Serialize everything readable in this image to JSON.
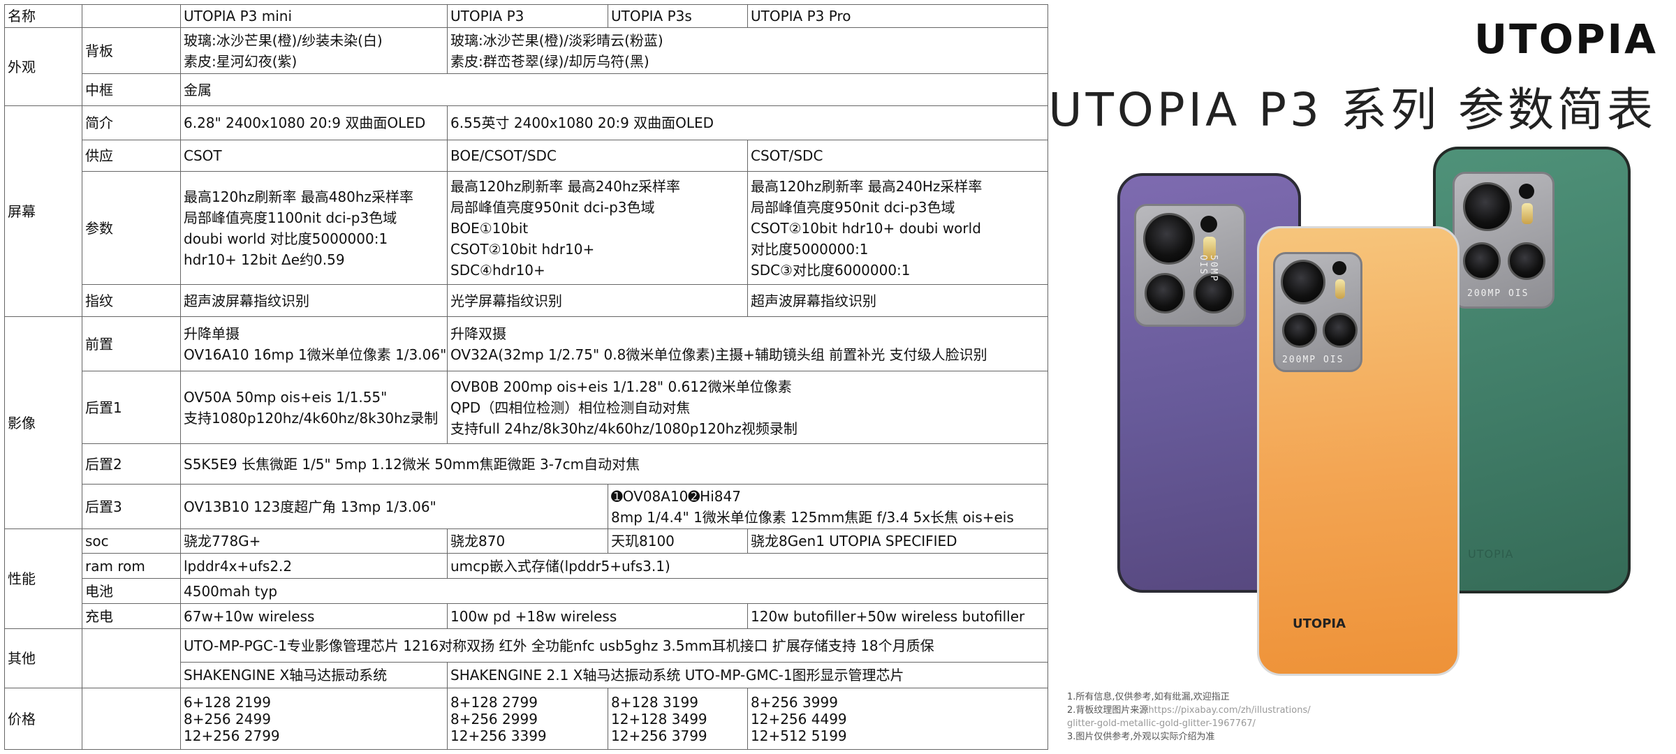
{
  "table": {
    "header": {
      "label": "名称",
      "models": [
        "UTOPIA P3 mini",
        "UTOPIA P3",
        "UTOPIA P3s",
        "UTOPIA P3 Pro"
      ]
    },
    "appearance": {
      "category": "外观",
      "back_label": "背板",
      "back_mini": [
        "玻璃:冰沙芒果(橙)/纱装未染(白)",
        "素皮:星河幻夜(紫)"
      ],
      "back_rest": [
        "玻璃:冰沙芒果(橙)/淡彩晴云(粉蓝)",
        "素皮:群峦苍翠(绿)/却厉乌符(黑)"
      ],
      "frame_label": "中框",
      "frame_value": "金属"
    },
    "screen": {
      "category": "屏幕",
      "intro_label": "简介",
      "intro_mini": "6.28\" 2400x1080 20:9 双曲面OLED",
      "intro_rest": "6.55英寸 2400x1080 20:9 双曲面OLED",
      "supply_label": "供应",
      "supply_mini": "CSOT",
      "supply_mid": "BOE/CSOT/SDC",
      "supply_pro": "CSOT/SDC",
      "params_label": "参数",
      "params_mini": [
        "最高120hz刷新率 最高480hz采样率",
        "局部峰值亮度1100nit dci-p3色域",
        "doubi world 对比度5000000:1",
        "hdr10+ 12bit Δe约0.59"
      ],
      "params_mid": [
        "最高120hz刷新率 最高240hz采样率",
        "局部峰值亮度950nit dci-p3色域",
        "BOE①10bit",
        "CSOT②10bit hdr10+",
        "SDC④hdr10+"
      ],
      "params_pro": [
        "最高120hz刷新率 最高240Hz采样率",
        "局部峰值亮度950nit dci-p3色域",
        "CSOT②10bit hdr10+ doubi world",
        "对比度5000000:1",
        "SDC③对比度6000000:1"
      ],
      "fp_label": "指纹",
      "fp_mini": "超声波屏幕指纹识别",
      "fp_mid": "光学屏幕指纹识别",
      "fp_pro": "超声波屏幕指纹识别"
    },
    "camera": {
      "category": "影像",
      "front_label": "前置",
      "front_mini": [
        "升降单摄",
        "OV16A10 16mp 1微米单位像素 1/3.06\""
      ],
      "front_rest": [
        "升降双摄",
        "OV32A(32mp 1/2.75\" 0.8微米单位像素)主摄+辅助镜头组 前置补光 支付级人脸识别"
      ],
      "rear1_label": "后置1",
      "rear1_mini": [
        "OV50A 50mp ois+eis 1/1.55\"",
        "支持1080p120hz/4k60hz/8k30hz录制"
      ],
      "rear1_rest": [
        "OVB0B 200mp ois+eis 1/1.28\" 0.612微米单位像素",
        "QPD（四相位检测）相位检测自动对焦",
        "支持full 24hz/8k30hz/4k60hz/1080p120hz视频录制"
      ],
      "rear2_label": "后置2",
      "rear2_value": "S5K5E9 长焦微距 1/5\" 5mp 1.12微米 50mm焦距微距 3-7cm自动对焦",
      "rear3_label": "后置3",
      "rear3_left": "OV13B10 123度超广角 13mp 1/3.06\"",
      "rear3_right": [
        "➊OV08A10➋Hi847",
        "8mp 1/4.4\" 1微米单位像素 125mm焦距 f/3.4 5x长焦 ois+eis"
      ]
    },
    "performance": {
      "category": "性能",
      "soc_label": "soc",
      "soc": [
        "骁龙778G+",
        "骁龙870",
        "天玑8100",
        "骁龙8Gen1 UTOPIA SPECIFIED"
      ],
      "ram_label": "ram rom",
      "ram_mini": "lpddr4x+ufs2.2",
      "ram_rest": "umcp嵌入式存储(lpddr5+ufs3.1)",
      "battery_label": "电池",
      "battery_value": "4500mah typ",
      "charge_label": "充电",
      "charge_mini": "67w+10w wireless",
      "charge_mid": "100w pd +18w wireless",
      "charge_pro": "120w butofiller+50w wireless butofiller"
    },
    "other": {
      "category": "其他",
      "line1": "UTO-MP-PGC-1专业影像管理芯片 1216对称双扬 红外 全功能nfc usb5ghz 3.5mm耳机接口 扩展存储支持 18个月质保",
      "line2_mini": "SHAKENGINE X轴马达振动系统",
      "line2_rest": "SHAKENGINE 2.1 X轴马达振动系统 UTO-MP-GMC-1图形显示管理芯片"
    },
    "price": {
      "category": "价格",
      "mini": [
        "6+128 2199",
        "8+256 2499",
        "12+256 2799"
      ],
      "p3": [
        "8+128 2799",
        "8+256 2999",
        "12+256 3399"
      ],
      "p3s": [
        "8+128 3199",
        "12+128 3499",
        "12+256 3799"
      ],
      "pro": [
        "8+256 3999",
        "12+256 4499",
        "12+512 5199"
      ]
    }
  },
  "brand": {
    "logo": "UTOPIA",
    "title": "UTOPIA P3 系列  参数简表"
  },
  "phones": {
    "purple_module_text": "50MP OIS",
    "orange_module_text": "200MP OIS",
    "green_module_text": "200MP OIS",
    "orange_brand": "UTOPIA",
    "green_brand": "UTOPIA",
    "colors": {
      "purple": "#6a5c9c",
      "orange": "#f3a553",
      "green": "#3f7b66"
    }
  },
  "notes": {
    "line1": "1.所有信息,仅供参考,如有纰漏,欢迎指正",
    "line2_prefix": "2.背板纹理图片来源",
    "line2_url": "https://pixabay.com/zh/illustrations/",
    "line2b": "glitter-gold-metallic-gold-glitter-1967767/",
    "line3": "3.图片仅供参考,外观以实际介绍为准"
  }
}
